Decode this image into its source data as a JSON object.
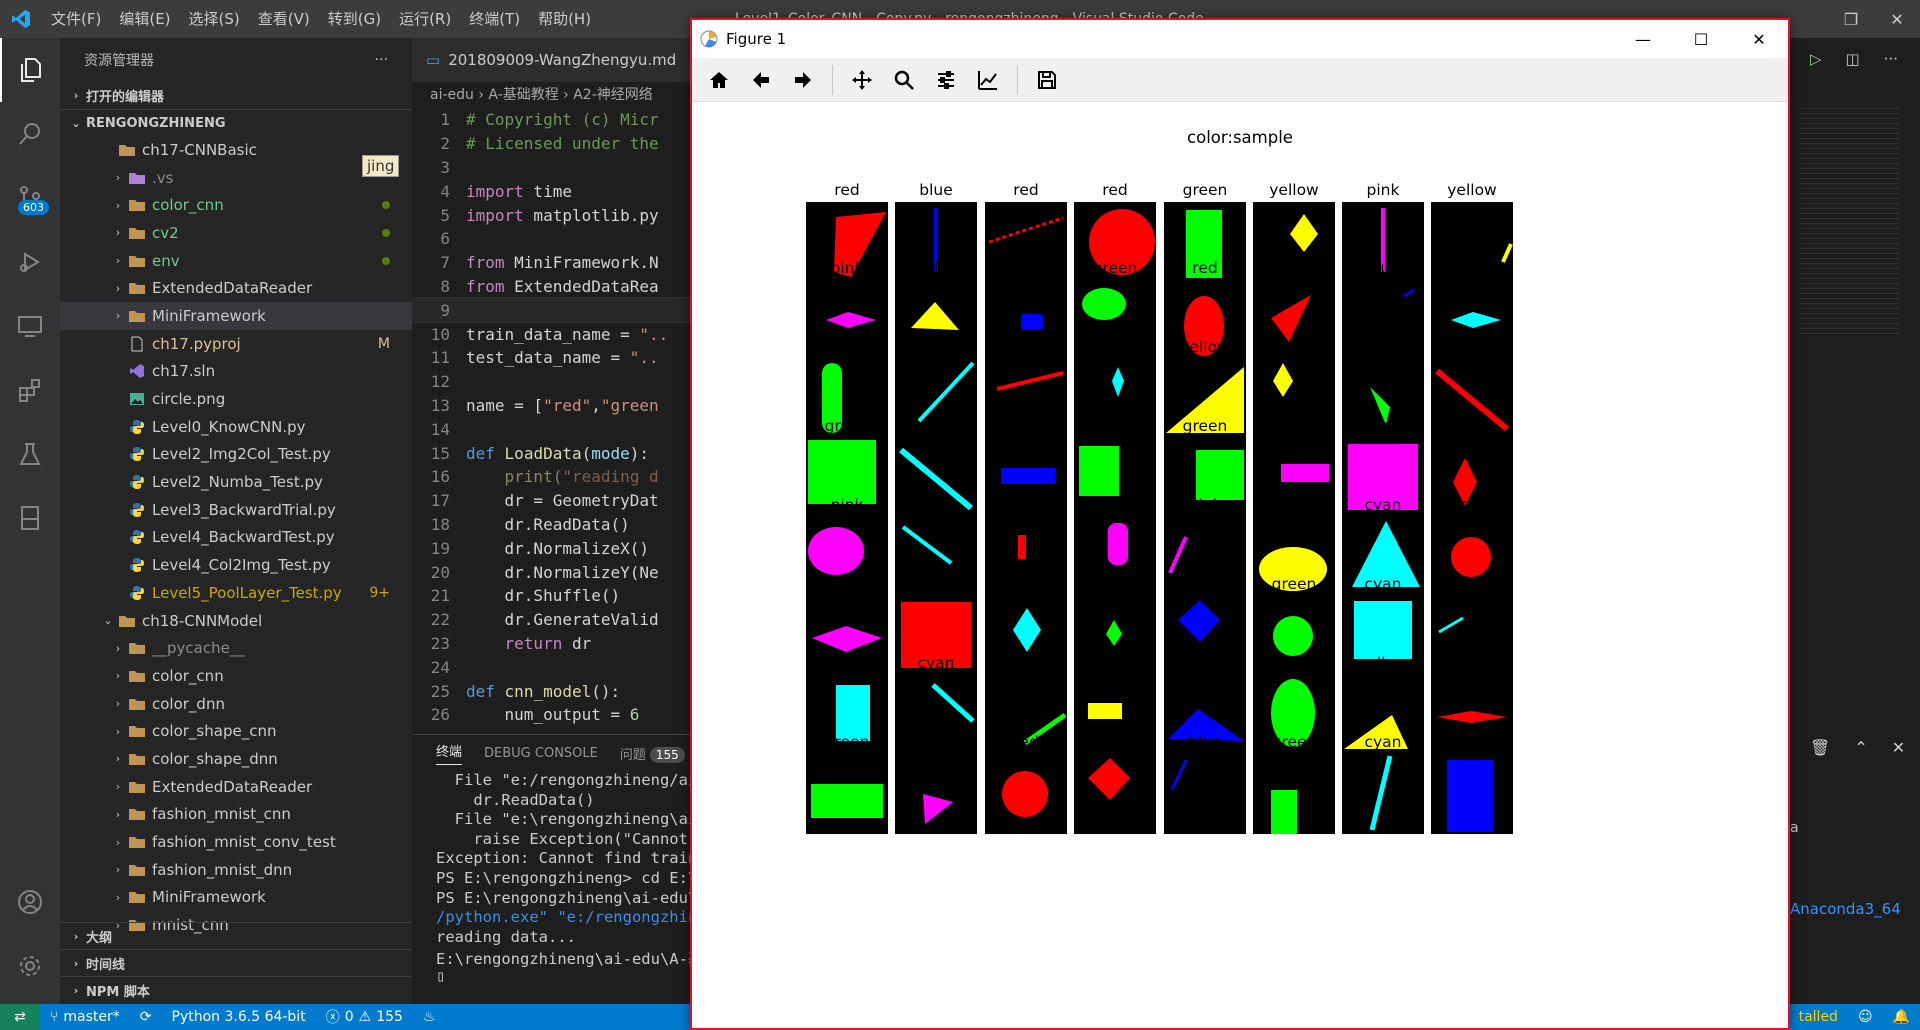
{
  "titlebar": {
    "menu": [
      "文件(F)",
      "编辑(E)",
      "选择(S)",
      "查看(V)",
      "转到(G)",
      "运行(R)",
      "终端(T)",
      "帮助(H)"
    ],
    "window_title": "Level1_Color_CNN - Copy.py - rengongzhineng - Visual Studio Code"
  },
  "activitybar": {
    "scm_badge": "603"
  },
  "sidebar": {
    "title": "资源管理器",
    "more": "···",
    "open_editors": "打开的编辑器",
    "root": "RENGONGZHINENG",
    "hover_tag": "jing",
    "tree": [
      {
        "name": "ch17-CNNBasic",
        "type": "folder-open",
        "indent": 1,
        "color": "#cccccc"
      },
      {
        "name": ".vs",
        "type": "vs-folder",
        "indent": 2,
        "color": "#8c8c8c",
        "twist": "›"
      },
      {
        "name": "color_cnn",
        "type": "folder",
        "indent": 2,
        "color": "#73c991",
        "twist": "›",
        "dot": true
      },
      {
        "name": "cv2",
        "type": "folder",
        "indent": 2,
        "color": "#73c991",
        "twist": "›",
        "dot": true
      },
      {
        "name": "env",
        "type": "folder",
        "indent": 2,
        "color": "#73c991",
        "twist": "›",
        "dot": true
      },
      {
        "name": "ExtendedDataReader",
        "type": "folder",
        "indent": 2,
        "color": "#cccccc",
        "twist": "›"
      },
      {
        "name": "MiniFramework",
        "type": "folder",
        "indent": 2,
        "color": "#cccccc",
        "twist": "›",
        "selected": true
      },
      {
        "name": "ch17.pyproj",
        "type": "file",
        "indent": 2,
        "color": "#e2c08d",
        "status": "M",
        "status_color": "#e2c08d"
      },
      {
        "name": "ch17.sln",
        "type": "vs-file",
        "indent": 2,
        "color": "#cccccc"
      },
      {
        "name": "circle.png",
        "type": "image",
        "indent": 2,
        "color": "#cccccc"
      },
      {
        "name": "Level0_KnowCNN.py",
        "type": "python",
        "indent": 2,
        "color": "#cccccc"
      },
      {
        "name": "Level2_Img2Col_Test.py",
        "type": "python",
        "indent": 2,
        "color": "#cccccc"
      },
      {
        "name": "Level2_Numba_Test.py",
        "type": "python",
        "indent": 2,
        "color": "#cccccc"
      },
      {
        "name": "Level3_BackwardTrial.py",
        "type": "python",
        "indent": 2,
        "color": "#cccccc"
      },
      {
        "name": "Level4_BackwardTest.py",
        "type": "python",
        "indent": 2,
        "color": "#cccccc"
      },
      {
        "name": "Level4_Col2Img_Test.py",
        "type": "python",
        "indent": 2,
        "color": "#cccccc"
      },
      {
        "name": "Level5_PoolLayer_Test.py",
        "type": "python",
        "indent": 2,
        "color": "#cca700",
        "status": "9+",
        "status_color": "#cca700"
      },
      {
        "name": "ch18-CNNModel",
        "type": "folder-open",
        "indent": 1,
        "color": "#cccccc",
        "twist": "⌄"
      },
      {
        "name": "__pycache__",
        "type": "folder",
        "indent": 2,
        "color": "#8c8c8c",
        "twist": "›"
      },
      {
        "name": "color_cnn",
        "type": "folder",
        "indent": 2,
        "color": "#cccccc",
        "twist": "›"
      },
      {
        "name": "color_dnn",
        "type": "folder",
        "indent": 2,
        "color": "#cccccc",
        "twist": "›"
      },
      {
        "name": "color_shape_cnn",
        "type": "folder",
        "indent": 2,
        "color": "#cccccc",
        "twist": "›"
      },
      {
        "name": "color_shape_dnn",
        "type": "folder",
        "indent": 2,
        "color": "#cccccc",
        "twist": "›"
      },
      {
        "name": "ExtendedDataReader",
        "type": "folder",
        "indent": 2,
        "color": "#cccccc",
        "twist": "›"
      },
      {
        "name": "fashion_mnist_cnn",
        "type": "folder",
        "indent": 2,
        "color": "#cccccc",
        "twist": "›"
      },
      {
        "name": "fashion_mnist_conv_test",
        "type": "folder",
        "indent": 2,
        "color": "#cccccc",
        "twist": "›"
      },
      {
        "name": "fashion_mnist_dnn",
        "type": "folder",
        "indent": 2,
        "color": "#cccccc",
        "twist": "›"
      },
      {
        "name": "MiniFramework",
        "type": "folder",
        "indent": 2,
        "color": "#cccccc",
        "twist": "›"
      },
      {
        "name": "mnist_cnn",
        "type": "folder",
        "indent": 2,
        "color": "#cccccc",
        "twist": "›"
      }
    ],
    "outline": "大纲",
    "timeline": "时间线",
    "npm": "NPM 脚本"
  },
  "editor": {
    "tab": "201809009-WangZhengyu.md",
    "breadcrumb": "ai-edu › A-基础教程 › A2-神经网络",
    "lines": [
      {
        "n": "1",
        "html": "<span class='c-comment'># Copyright (c) Micr</span>"
      },
      {
        "n": "2",
        "html": "<span class='c-comment'># Licensed under the</span>"
      },
      {
        "n": "3",
        "html": ""
      },
      {
        "n": "4",
        "html": "<span class='c-kw2'>import</span> time"
      },
      {
        "n": "5",
        "html": "<span class='c-kw2'>import</span> matplotlib.py"
      },
      {
        "n": "6",
        "html": ""
      },
      {
        "n": "7",
        "html": "<span class='c-kw2'>from</span> MiniFramework.N"
      },
      {
        "n": "8",
        "html": "<span class='c-kw2'>from</span> ExtendedDataRea"
      },
      {
        "n": "9",
        "html": "",
        "current": true
      },
      {
        "n": "10",
        "html": "train_data_name = <span class='c-str'>\"..</span>"
      },
      {
        "n": "11",
        "html": "test_data_name = <span class='c-str'>\"..</span>"
      },
      {
        "n": "12",
        "html": ""
      },
      {
        "n": "13",
        "html": "name = [<span class='c-str'>\"red\"</span>,<span class='c-str'>\"green</span>"
      },
      {
        "n": "14",
        "html": ""
      },
      {
        "n": "15",
        "html": "<span class='c-kw'>def</span> <span class='c-fn'>LoadData</span>(<span class='c-param'>mode</span>):"
      },
      {
        "n": "16",
        "html": "    <span class='c-fn' style='opacity:.55'>print</span><span style='opacity:.55'>(</span><span class='c-str' style='opacity:.55'>\"reading d</span>"
      },
      {
        "n": "17",
        "html": "    dr = GeometryDat"
      },
      {
        "n": "18",
        "html": "    dr.ReadData()"
      },
      {
        "n": "19",
        "html": "    dr.NormalizeX()"
      },
      {
        "n": "20",
        "html": "    dr.NormalizeY(Ne"
      },
      {
        "n": "21",
        "html": "    dr.Shuffle()"
      },
      {
        "n": "22",
        "html": "    dr.GenerateValid"
      },
      {
        "n": "23",
        "html": "    <span class='c-kw2'>return</span> dr"
      },
      {
        "n": "24",
        "html": ""
      },
      {
        "n": "25",
        "html": "<span class='c-kw'>def</span> <span class='c-fn'>cnn_model</span>():"
      },
      {
        "n": "26",
        "html": "    num_output = <span class='c-num'>6</span>"
      }
    ]
  },
  "panel": {
    "tabs": [
      "终端",
      "DEBUG CONSOLE",
      "问题"
    ],
    "problem_count": "155",
    "terminal": [
      {
        "t": "  File \"e:/rengongzhineng/ai"
      },
      {
        "t": "    dr.ReadData()"
      },
      {
        "t": "  File \"e:\\rengongzhineng\\ai"
      },
      {
        "t": "    raise Exception(\"Cannot"
      },
      {
        "t": "Exception: Cannot find train"
      },
      {
        "t": "PS E:\\rengongzhineng> cd E:\\"
      },
      {
        "t": "PS E:\\rengongzhineng\\ai-edu\\"
      },
      {
        "t": "/python.exe\" \"e:/rengongzhin",
        "blue": true
      },
      {
        "t": "reading data..."
      },
      {
        "t": "E:\\rengongzhineng\\ai-edu\\A-基"
      },
      {
        "t": "▯"
      }
    ]
  },
  "right_strip": {
    "a_text": "a",
    "anaconda": "Anaconda3_64",
    "installed": "talled"
  },
  "statusbar": {
    "branch": "master*",
    "python": "Python 3.6.5 64-bit",
    "errors": "0",
    "warnings": "155"
  },
  "figure": {
    "title": "Figure 1",
    "suptitle": "color:sample",
    "colors": {
      "red": "#ff0000",
      "blue": "#0000ff",
      "green": "#00ff00",
      "yellow": "#ffff00",
      "pink": "#ff00ff",
      "cyan": "#00ffff"
    },
    "cells": [
      {
        "label": "red",
        "shape": "triangle",
        "color": "red",
        "v": "A"
      },
      {
        "label": "blue",
        "shape": "vline",
        "color": "blue"
      },
      {
        "label": "red",
        "shape": "dashed",
        "color": "red"
      },
      {
        "label": "red",
        "shape": "circle",
        "color": "red",
        "v": "big"
      },
      {
        "label": "green",
        "shape": "rect",
        "color": "green",
        "v": "tall"
      },
      {
        "label": "yellow",
        "shape": "diamond",
        "color": "yellow",
        "v": "small"
      },
      {
        "label": "pink",
        "shape": "vline",
        "color": "pink"
      },
      {
        "label": "yellow",
        "shape": "cornerline",
        "color": "yellow"
      },
      {
        "label": "pink",
        "shape": "hdiamond",
        "color": "pink"
      },
      {
        "label": "yellow",
        "shape": "triangle",
        "color": "yellow",
        "v": "B"
      },
      {
        "label": "blue",
        "shape": "smallrect",
        "color": "blue"
      },
      {
        "label": "green",
        "shape": "ellipse",
        "color": "green",
        "v": "h"
      },
      {
        "label": "red",
        "shape": "ellipse",
        "color": "red",
        "v": "v"
      },
      {
        "label": "red",
        "shape": "triangle",
        "color": "red",
        "v": "C"
      },
      {
        "label": "blue",
        "shape": "tinyline",
        "color": "blue"
      },
      {
        "label": "cyan",
        "shape": "hdiamond",
        "color": "cyan"
      },
      {
        "label": "green",
        "shape": "capsule",
        "color": "green"
      },
      {
        "label": "cyan",
        "shape": "diagline",
        "color": "cyan"
      },
      {
        "label": "red",
        "shape": "slightline",
        "color": "red"
      },
      {
        "label": "cyan",
        "shape": "vdiamond",
        "color": "cyan"
      },
      {
        "label": "yellow",
        "shape": "bigtriangle",
        "color": "yellow"
      },
      {
        "label": "yellow",
        "shape": "diamond",
        "color": "yellow",
        "v": "mid"
      },
      {
        "label": "green",
        "shape": "leaf",
        "color": "green"
      },
      {
        "label": "red",
        "shape": "longdiag",
        "color": "red"
      },
      {
        "label": "green",
        "shape": "rect",
        "color": "green",
        "v": "square"
      },
      {
        "label": "cyan",
        "shape": "longdiag",
        "color": "cyan"
      },
      {
        "label": "blue",
        "shape": "rect",
        "color": "blue",
        "v": "flat"
      },
      {
        "label": "green",
        "shape": "rect",
        "color": "green",
        "v": "mid"
      },
      {
        "label": "green",
        "shape": "rect",
        "color": "green",
        "v": "mid2"
      },
      {
        "label": "pink",
        "shape": "rect",
        "color": "pink",
        "v": "flat2"
      },
      {
        "label": "pink",
        "shape": "rect",
        "color": "pink",
        "v": "big"
      },
      {
        "label": "red",
        "shape": "vdiamond2",
        "color": "red"
      },
      {
        "label": "pink",
        "shape": "ellipse",
        "color": "pink",
        "v": "big"
      },
      {
        "label": "cyan",
        "shape": "diagline2",
        "color": "cyan"
      },
      {
        "label": "red",
        "shape": "rect",
        "color": "red",
        "v": "thin"
      },
      {
        "label": "pink",
        "shape": "capsule2",
        "color": "pink"
      },
      {
        "label": "pink",
        "shape": "slant",
        "color": "pink"
      },
      {
        "label": "yellow",
        "shape": "ellipse",
        "color": "yellow",
        "v": "wide"
      },
      {
        "label": "cyan",
        "shape": "bigtriangle2",
        "color": "cyan"
      },
      {
        "label": "red",
        "shape": "circle",
        "color": "red",
        "v": "mid"
      },
      {
        "label": "pink",
        "shape": "hdiamond",
        "color": "pink",
        "v": "big"
      },
      {
        "label": "red",
        "shape": "rect",
        "color": "red",
        "v": "big"
      },
      {
        "label": "cyan",
        "shape": "vdiamond3",
        "color": "cyan"
      },
      {
        "label": "green",
        "shape": "diamond",
        "color": "green",
        "v": "small2"
      },
      {
        "label": "blue",
        "shape": "diamond",
        "color": "blue",
        "v": "big"
      },
      {
        "label": "green",
        "shape": "circle",
        "color": "green",
        "v": "mid"
      },
      {
        "label": "cyan",
        "shape": "rect",
        "color": "cyan",
        "v": "bigsq"
      },
      {
        "label": "cyan",
        "shape": "tinyline2",
        "color": "cyan"
      },
      {
        "label": "cyan",
        "shape": "rect",
        "color": "cyan",
        "v": "vert"
      },
      {
        "label": "cyan",
        "shape": "diagline3",
        "color": "cyan"
      },
      {
        "label": "green",
        "shape": "diagline4",
        "color": "green"
      },
      {
        "label": "yellow",
        "shape": "rect",
        "color": "yellow",
        "v": "small"
      },
      {
        "label": "blue",
        "shape": "bigtriangle3",
        "color": "blue"
      },
      {
        "label": "green",
        "shape": "ellipse",
        "color": "green",
        "v": "tall"
      },
      {
        "label": "yellow",
        "shape": "bigtriangle4",
        "color": "yellow"
      },
      {
        "label": "red",
        "shape": "hdiamond",
        "color": "red",
        "v": "flat"
      },
      {
        "label": "green",
        "shape": "rect",
        "color": "green",
        "v": "wide"
      },
      {
        "label": "pink",
        "shape": "triangle",
        "color": "pink",
        "v": "D"
      },
      {
        "label": "red",
        "shape": "circle",
        "color": "red",
        "v": "mid2"
      },
      {
        "label": "red",
        "shape": "diamond",
        "color": "red",
        "v": "big"
      },
      {
        "label": "blue",
        "shape": "slant2",
        "color": "blue"
      },
      {
        "label": "green",
        "shape": "rect",
        "color": "green",
        "v": "bottom"
      },
      {
        "label": "cyan",
        "shape": "vslant",
        "color": "cyan"
      },
      {
        "label": "blue",
        "shape": "rect",
        "color": "blue",
        "v": "tallbig"
      }
    ]
  }
}
